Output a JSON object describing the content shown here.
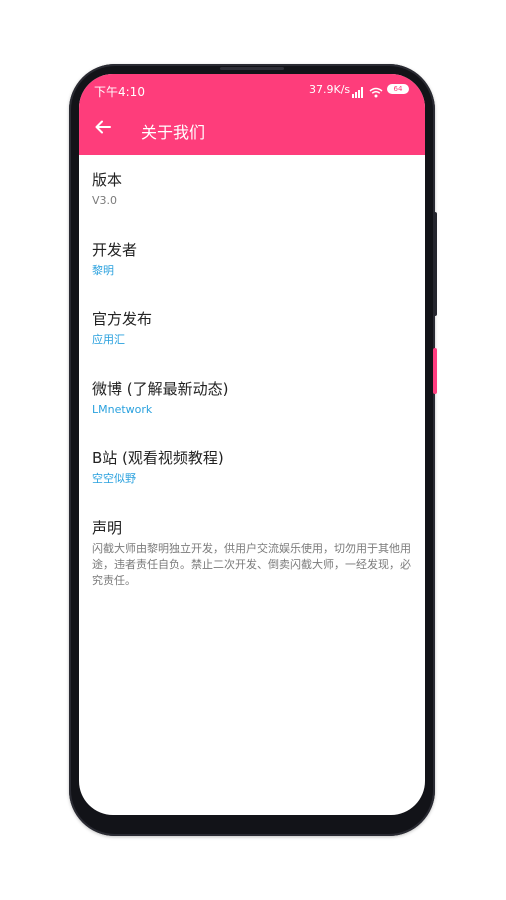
{
  "status_bar": {
    "time": "下午4:10",
    "net_speed": "37.9K/s",
    "battery": "64"
  },
  "header": {
    "title": "关于我们"
  },
  "items": [
    {
      "title": "版本",
      "value": "V3.0"
    },
    {
      "title": "开发者",
      "value": "黎明"
    },
    {
      "title": "官方发布",
      "value": "应用汇"
    },
    {
      "title": "微博 (了解最新动态)",
      "value": "LMnetwork"
    },
    {
      "title": "B站 (观看视频教程)",
      "value": "空空似野"
    }
  ],
  "declaration": {
    "title": "声明",
    "body": "闪截大师由黎明独立开发，供用户交流娱乐使用，切勿用于其他用途，违者责任自负。禁止二次开发、倒卖闪截大师，一经发现，必究责任。"
  },
  "colors": {
    "accent": "#fe3d7b",
    "link": "#2aa1de",
    "secondary_text": "#7b7b7b"
  }
}
